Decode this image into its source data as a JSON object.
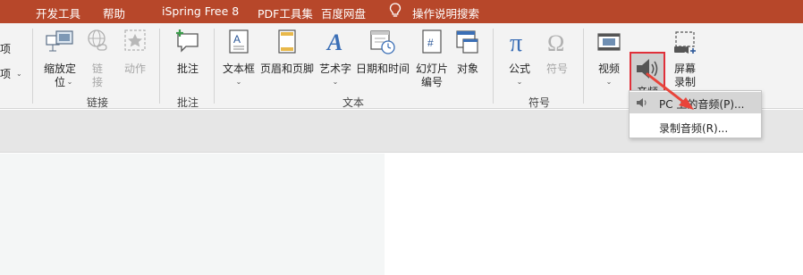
{
  "menu_tabs": [
    "开发工具",
    "帮助",
    "iSpring Free 8",
    "PDF工具集",
    "百度网盘"
  ],
  "tell_me": "操作说明搜索",
  "left_partial": [
    "项",
    "项"
  ],
  "groups": {
    "links": {
      "label": "链接",
      "zoom": {
        "line1": "缩放定",
        "line2": "位"
      },
      "link": {
        "line1": "链",
        "line2": "接"
      },
      "action": "动作"
    },
    "comments": {
      "label": "批注",
      "comment": "批注"
    },
    "text": {
      "label": "文本",
      "textbox": "文本框",
      "header_footer": "页眉和页脚",
      "wordart": "艺术字",
      "datetime": "日期和时间",
      "slide_number": {
        "line1": "幻灯片",
        "line2": "编号"
      },
      "object": "对象"
    },
    "symbols": {
      "label": "符号",
      "equation": "公式",
      "symbol": "符号"
    },
    "media": {
      "video": "视频",
      "audio": "音频",
      "screen_recording": {
        "line1": "屏幕",
        "line2": "录制"
      }
    }
  },
  "dropdown": {
    "items": [
      {
        "label": "PC 上的音频(P)..."
      },
      {
        "label": "录制音频(R)..."
      }
    ]
  },
  "colors": {
    "menu_bar": "#b7472a",
    "highlight_border": "#e0303a",
    "arrow": "#e8443a"
  }
}
